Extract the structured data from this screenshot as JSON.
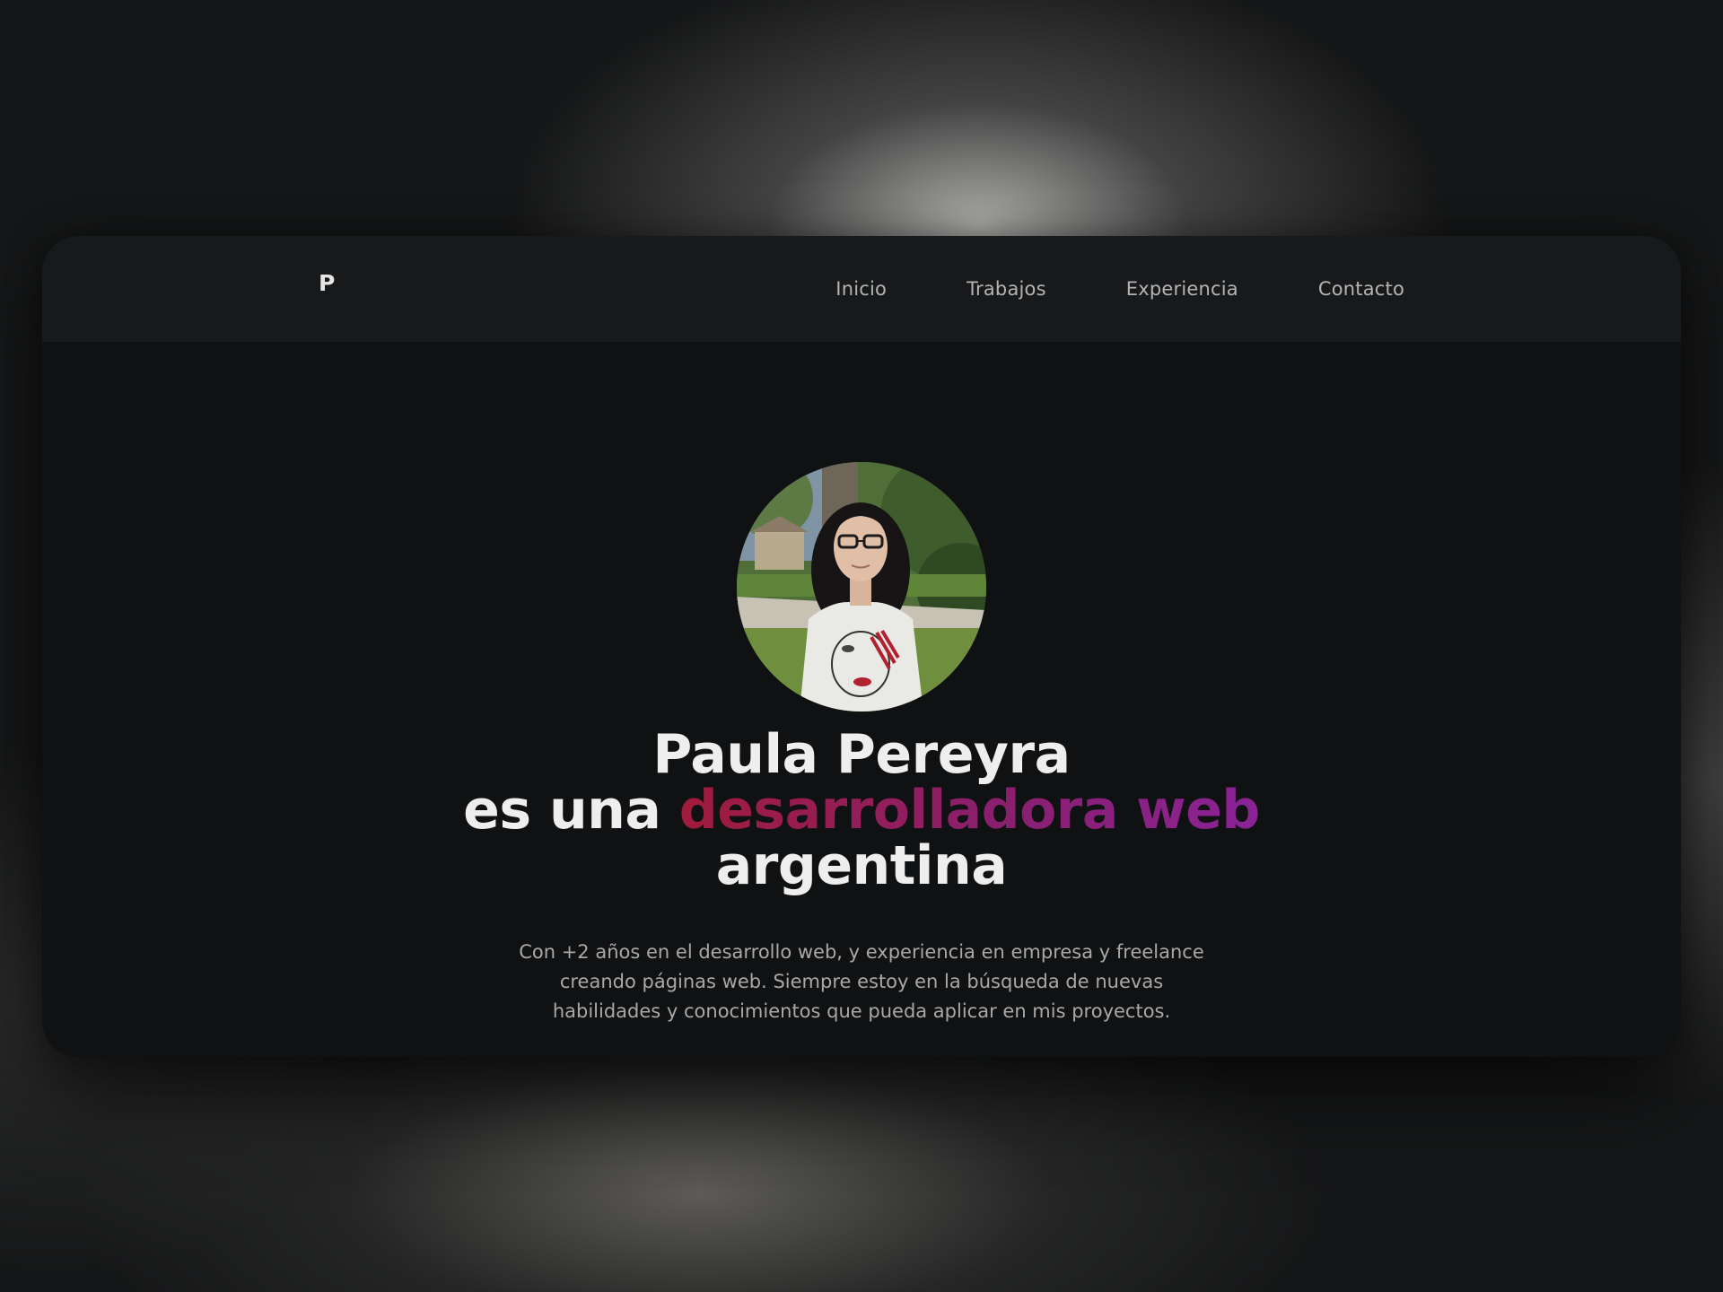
{
  "nav": {
    "logo": "P",
    "links": [
      {
        "label": "Inicio"
      },
      {
        "label": "Trabajos"
      },
      {
        "label": "Experiencia"
      },
      {
        "label": "Contacto"
      }
    ]
  },
  "hero": {
    "name": "Paula Pereyra",
    "line2_prefix": "es una ",
    "line2_accent": "desarrolladora web",
    "line3": "argentina",
    "description_lines": [
      "Con +2 años en el desarrollo web, y experiencia en empresa y freelance",
      "creando páginas web. Siempre estoy en la búsqueda de nuevas",
      "habilidades y conocimientos que pueda aplicar en mis proyectos."
    ]
  },
  "colors": {
    "background": "#161718",
    "window": "#101112",
    "navbar": "#18191b",
    "accent_start": "#a01c3c",
    "accent_end": "#8a2396"
  }
}
